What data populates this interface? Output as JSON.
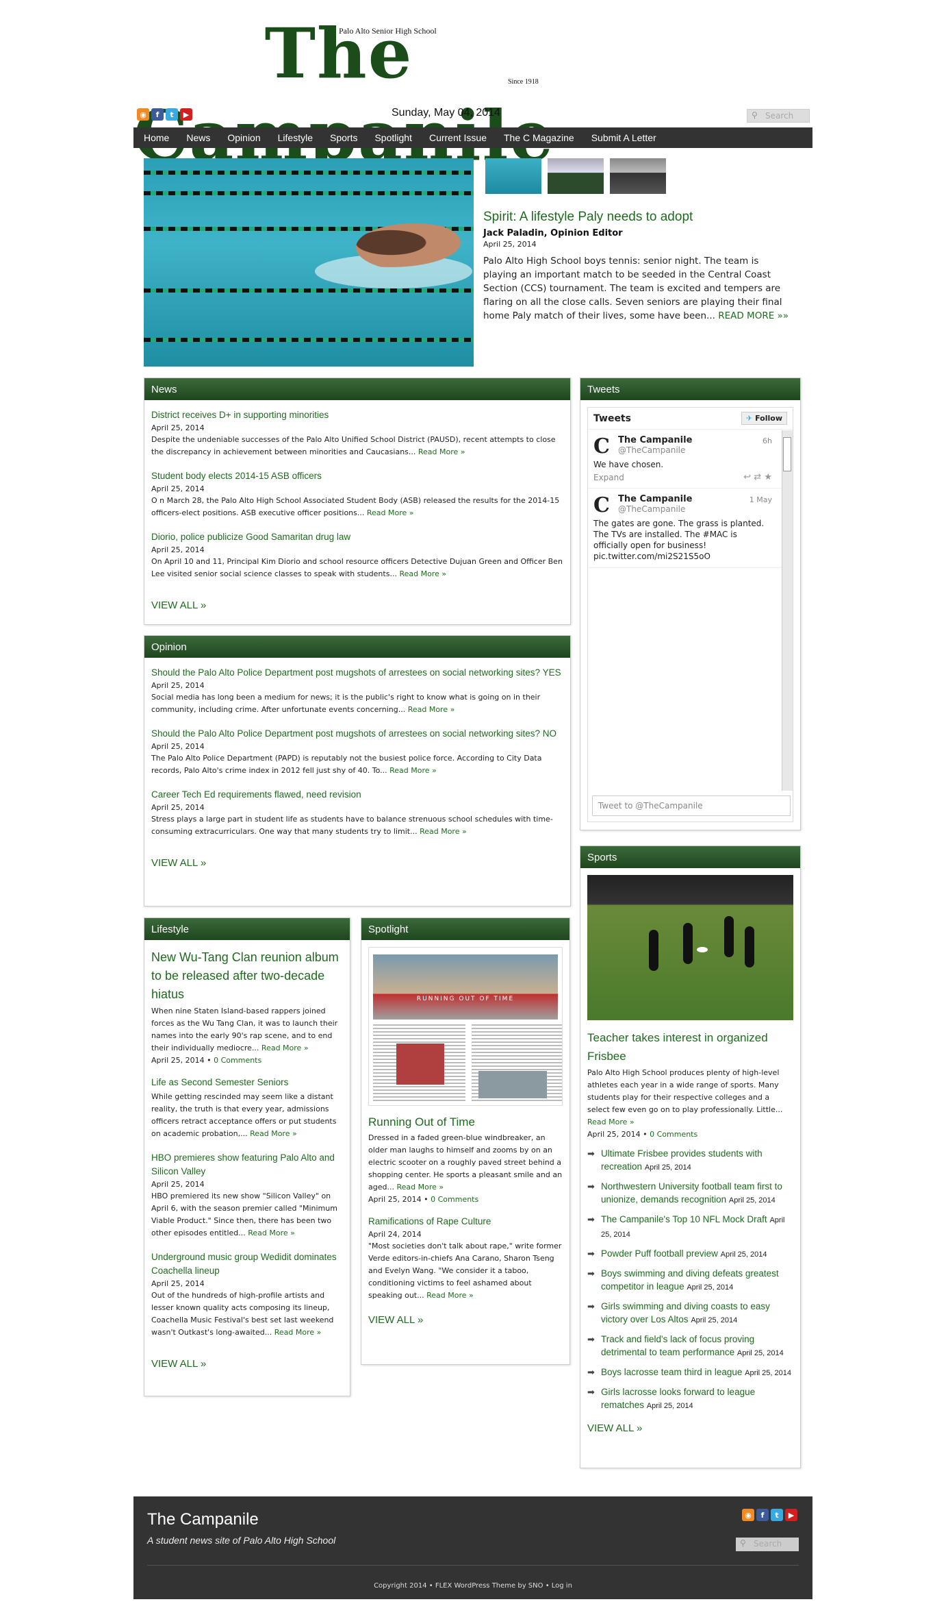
{
  "masthead": {
    "title": "The Campanile",
    "school": "Palo Alto Senior High School",
    "since": "Since 1918"
  },
  "header": {
    "date": "Sunday, May 04, 2014",
    "search_placeholder": "Search"
  },
  "nav": [
    "Home",
    "News",
    "Opinion",
    "Lifestyle",
    "Sports",
    "Spotlight",
    "Current Issue",
    "The C Magazine",
    "Submit A Letter"
  ],
  "hero": {
    "title": "Spirit: A lifestyle Paly needs to adopt",
    "author": "Jack Paladin, Opinion Editor",
    "date": "April 25, 2014",
    "excerpt": "Palo Alto High School boys tennis: senior night. The team is playing an important match to be seeded in the Central Coast Section (CCS) tournament. The team is excited and tempers are flaring on all the close calls. Seven seniors are playing their final home Paly match of their lives, some have been...",
    "read_more": "READ MORE »»"
  },
  "news": {
    "heading": "News",
    "articles": [
      {
        "title": "District receives D+ in supporting minorities",
        "date": "April 25, 2014",
        "excerpt": "Despite the undeniable successes of the Palo Alto Unified School District (PAUSD), recent attempts to close the discrepancy in achievement between minorities and Caucasians...",
        "more": "Read More »"
      },
      {
        "title": "Student body elects 2014-15 ASB officers",
        "date": "April 25, 2014",
        "excerpt": "O n March 28, the Palo Alto High School Associated Student Body (ASB) released the results for the 2014-15 officers-elect positions. ASB executive officer positions...",
        "more": "Read More »"
      },
      {
        "title": "Diorio, police publicize Good Samaritan drug law",
        "date": "April 25, 2014",
        "excerpt": "On April 10 and 11, Principal Kim Diorio and school resource officers Detective Dujuan Green and Officer Ben Lee visited senior social science classes to speak with students...",
        "more": "Read More »"
      }
    ],
    "view_all": "VIEW ALL »"
  },
  "opinion": {
    "heading": "Opinion",
    "articles": [
      {
        "title": "Should the Palo Alto Police Department post mugshots of arrestees on social networking sites? YES",
        "date": "April 25, 2014",
        "excerpt": "Social media has long been a medium for news; it is the public's right to know what is going on in their community, including crime. After unfortunate events concerning...",
        "more": "Read More »"
      },
      {
        "title": "Should the Palo Alto Police Department post mugshots of arrestees on social networking sites? NO",
        "date": "April 25, 2014",
        "excerpt": "The Palo Alto Police Department (PAPD) is reputably not the busiest police force. According to City Data records, Palo Alto's crime index in 2012 fell just shy of 40. To...",
        "more": "Read More »"
      },
      {
        "title": "Career Tech Ed requirements flawed, need revision",
        "date": "April 25, 2014",
        "excerpt": "Stress plays a large part in student life as students have to balance strenuous school schedules with time-consuming extracurriculars. One way that many students try to limit...",
        "more": "Read More »"
      }
    ],
    "view_all": "VIEW ALL »"
  },
  "lifestyle": {
    "heading": "Lifestyle",
    "lead": {
      "title": "New Wu-Tang Clan reunion album to be released after two-decade hiatus",
      "excerpt": "When nine Staten Island-based rappers joined forces as the Wu Tang Clan, it was to launch their names into the early 90's rap scene, and to end their individually mediocre...",
      "more": "Read More »",
      "date": "April 25, 2014",
      "comments": "0 Comments"
    },
    "articles": [
      {
        "title": "Life as Second Semester Seniors",
        "excerpt": "While getting rescinded may seem like a distant reality, the truth is that every year, admissions officers retract acceptance offers or put students on academic probation,...",
        "more": "Read More »"
      },
      {
        "title": "HBO premieres show featuring Palo Alto and Silicon Valley",
        "date": "April 25, 2014",
        "excerpt": "HBO premiered its new show \"Silicon Valley\" on April 6, with the season premier called \"Minimum Viable Product.\" Since then, there has been two other episodes entitled...",
        "more": "Read More »"
      },
      {
        "title": "Underground music group Wedidit dominates Coachella lineup",
        "date": "April 25, 2014",
        "excerpt": "Out of the hundreds of high-profile artists and lesser known quality acts composing its lineup, Coachella Music Festival's best set last weekend wasn't Outkast's long-awaited...",
        "more": "Read More »"
      }
    ],
    "view_all": "VIEW ALL »"
  },
  "spotlight": {
    "heading": "Spotlight",
    "image_banner": "RUNNING OUT OF TIME",
    "lead": {
      "title": "Running Out of Time",
      "excerpt": "Dressed in a faded green-blue windbreaker, an older man laughs to himself and zooms by on an electric scooter on a roughly paved street behind a shopping center. He sports a pleasant smile and an aged...",
      "more": "Read More »",
      "date": "April 25, 2014",
      "comments": "0 Comments"
    },
    "articles": [
      {
        "title": "Ramifications of Rape Culture",
        "date": "April 24, 2014",
        "excerpt": "\"Most societies don't talk about rape,\" write former Verde editors-in-chiefs Ana Carano, Sharon Tseng and Evelyn Wang. \"We consider it a taboo, conditioning victims to feel ashamed about speaking out...",
        "more": "Read More »"
      }
    ],
    "view_all": "VIEW ALL »"
  },
  "tweets": {
    "heading": "Tweets",
    "widget_title": "Tweets",
    "follow": "Follow",
    "items": [
      {
        "name": "The Campanile",
        "handle": "@TheCampanile",
        "time": "6h",
        "text": "We have chosen.",
        "expand": "Expand"
      },
      {
        "name": "The Campanile",
        "handle": "@TheCampanile",
        "time": "1 May",
        "text": "The gates are gone. The grass is planted. The TVs are installed. The #MAC is officially open for business! pic.twitter.com/mi2S21S5oO"
      }
    ],
    "compose_placeholder": "Tweet to @TheCampanile"
  },
  "sports": {
    "heading": "Sports",
    "lead": {
      "title": "Teacher takes interest in organized Frisbee",
      "excerpt": "Palo Alto High School produces plenty of high-level athletes each year in a wide range of sports. Many students play for their respective colleges and a select few even go on to play professionally. Little...",
      "more": "Read More »",
      "date": "April 25, 2014",
      "comments": "0 Comments"
    },
    "list": [
      {
        "title": "Ultimate Frisbee provides students with recreation",
        "date": "April 25, 2014"
      },
      {
        "title": "Northwestern University football team first to unionize, demands recognition",
        "date": "April 25, 2014"
      },
      {
        "title": "The Campanile's Top 10 NFL Mock Draft",
        "date": "April 25, 2014"
      },
      {
        "title": "Powder Puff football preview",
        "date": "April 25, 2014"
      },
      {
        "title": "Boys swimming and diving defeats greatest competitor in league",
        "date": "April 25, 2014"
      },
      {
        "title": "Girls swimming and diving coasts to easy victory over Los Altos",
        "date": "April 25, 2014"
      },
      {
        "title": "Track and field's lack of focus proving detrimental to team performance",
        "date": "April 25, 2014"
      },
      {
        "title": "Boys lacrosse team third in league",
        "date": "April 25, 2014"
      },
      {
        "title": "Girls lacrosse looks forward to league rematches",
        "date": "April 25, 2014"
      }
    ],
    "view_all": "VIEW ALL »"
  },
  "footer": {
    "title": "The Campanile",
    "subtitle": "A student news site of Palo Alto High School",
    "search_placeholder": "Search",
    "copyright": "Copyright 2014 • FLEX WordPress Theme by SNO • Log in"
  }
}
